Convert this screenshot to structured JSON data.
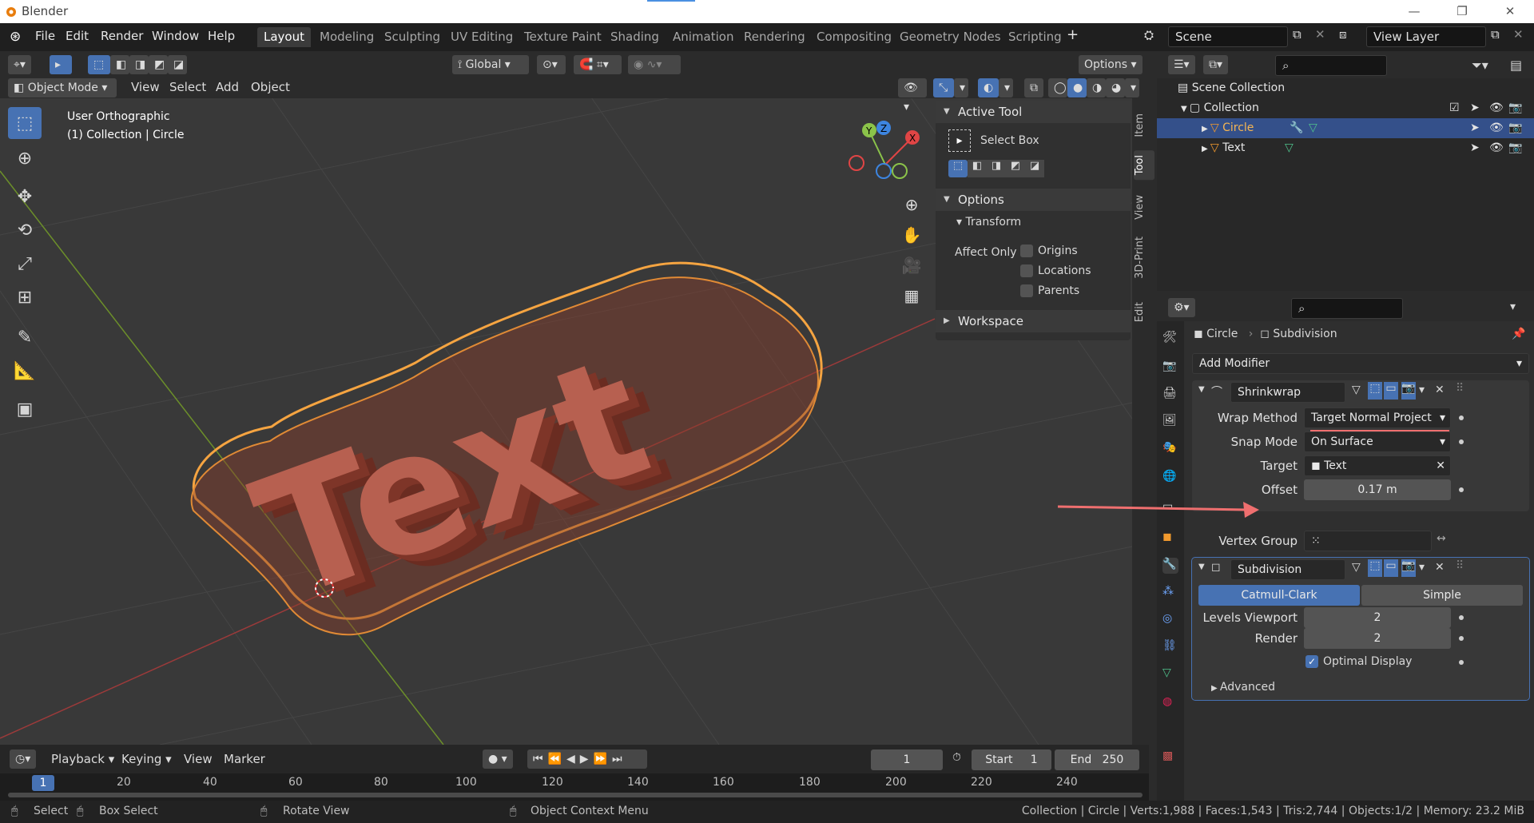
{
  "app": {
    "title": "Blender",
    "logo": "blender-logo-icon"
  },
  "menus": [
    "File",
    "Edit",
    "Render",
    "Window",
    "Help"
  ],
  "workspaces": [
    "Layout",
    "Modeling",
    "Sculpting",
    "UV Editing",
    "Texture Paint",
    "Shading",
    "Animation",
    "Rendering",
    "Compositing",
    "Geometry Nodes",
    "Scripting"
  ],
  "scene": {
    "label": "Scene",
    "view_layer": "View Layer"
  },
  "viewport": {
    "mode": "Object Mode",
    "menus": [
      "View",
      "Select",
      "Add",
      "Object"
    ],
    "transform_orientation": "Global",
    "options": "Options",
    "overlay_title": "User Orthographic",
    "overlay_sub": "(1) Collection | Circle",
    "text_object": "Text"
  },
  "npanel": {
    "tabs": [
      "Item",
      "Tool",
      "View",
      "3D-Print",
      "Edit"
    ],
    "active_tool_header": "Active Tool",
    "active_tool": "Select Box",
    "options_header": "Options",
    "transform_header": "Transform",
    "affect_only": "Affect Only",
    "checks": [
      "Origins",
      "Locations",
      "Parents"
    ],
    "workspace_header": "Workspace"
  },
  "outliner": {
    "scene_collection": "Scene Collection",
    "collection": "Collection",
    "objects": [
      "Circle",
      "Text"
    ]
  },
  "properties": {
    "breadcrumb_object": "Circle",
    "breadcrumb_modifier": "Subdivision",
    "add_modifier": "Add Modifier",
    "shrinkwrap": {
      "name": "Shrinkwrap",
      "wrap_method_label": "Wrap Method",
      "wrap_method": "Target Normal Project",
      "snap_mode_label": "Snap Mode",
      "snap_mode": "On Surface",
      "target_label": "Target",
      "target": "Text",
      "offset_label": "Offset",
      "offset": "0.17 m",
      "vertex_group_label": "Vertex Group"
    },
    "subdivision": {
      "name": "Subdivision",
      "tab_catmull": "Catmull-Clark",
      "tab_simple": "Simple",
      "levels_label": "Levels Viewport",
      "levels": "2",
      "render_label": "Render",
      "render": "2",
      "optimal": "Optimal Display",
      "advanced": "Advanced"
    }
  },
  "timeline": {
    "menus": [
      "Playback",
      "Keying",
      "View",
      "Marker"
    ],
    "current_frame": "1",
    "start_label": "Start",
    "start": "1",
    "end_label": "End",
    "end": "250",
    "ticks": [
      "1",
      "20",
      "40",
      "60",
      "80",
      "100",
      "120",
      "140",
      "160",
      "180",
      "200",
      "220",
      "240"
    ]
  },
  "status": {
    "select": "Select",
    "box_select": "Box Select",
    "rotate_view": "Rotate View",
    "context_menu": "Object Context Menu",
    "stats": "Collection | Circle | Verts:1,988 | Faces:1,543 | Tris:2,744 | Objects:1/2 | Memory: 23.2 MiB"
  },
  "colors": {
    "accent": "#4772b3",
    "selection_orange": "#f29a2e",
    "annotation": "#ef6f6f",
    "text_object": "#b76050"
  }
}
